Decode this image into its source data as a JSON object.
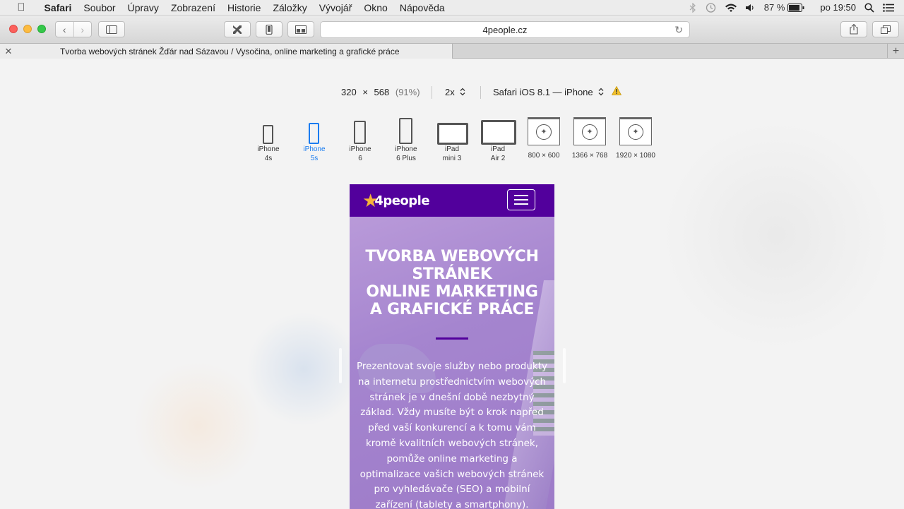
{
  "menubar": {
    "app": "Safari",
    "items": [
      "Soubor",
      "Úpravy",
      "Zobrazení",
      "Historie",
      "Záložky",
      "Vývojář",
      "Okno",
      "Nápověda"
    ],
    "battery": "87 %",
    "clock": "po 19:50"
  },
  "toolbar": {
    "url": "4people.cz"
  },
  "tab": {
    "title": "Tvorba webových stránek Žďár nad Sázavou / Vysočina, online marketing a grafické práce"
  },
  "responsive": {
    "width": "320",
    "times": "×",
    "height": "568",
    "percent": "(91%)",
    "scale": "2x",
    "user_agent": "Safari iOS 8.1 — iPhone",
    "devices": [
      {
        "line1": "iPhone",
        "line2": "4s"
      },
      {
        "line1": "iPhone",
        "line2": "5s"
      },
      {
        "line1": "iPhone",
        "line2": "6"
      },
      {
        "line1": "iPhone",
        "line2": "6 Plus"
      },
      {
        "line1": "iPad",
        "line2": "mini 3"
      },
      {
        "line1": "iPad",
        "line2": "Air 2"
      },
      {
        "line1": "800 × 600",
        "line2": ""
      },
      {
        "line1": "1366 × 768",
        "line2": ""
      },
      {
        "line1": "1920 × 1080",
        "line2": ""
      }
    ],
    "selected_device": "iPhone 5s"
  },
  "site": {
    "logo_text": "4people",
    "hero_title_lines": [
      "TVORBA WEBOVÝCH",
      "STRÁNEK",
      "ONLINE MARKETING",
      "A GRAFICKÉ PRÁCE"
    ],
    "hero_text": "Prezentovat svoje služby nebo produkty na internetu prostřednictvím webových stránek je v dnešní době nezbytný základ. Vždy musíte být o krok napřed před vaší konkurencí a k tomu vám kromě kvalitních webových stránek, pomůže online marketing a optimalizace vašich webových stránek pro vyhledávače (SEO) a mobilní zařízení (tablety a smartphony)."
  },
  "colors": {
    "site_header": "#52009c",
    "selected_device": "#1a7cf0",
    "logo_star": "#f5b33a"
  }
}
